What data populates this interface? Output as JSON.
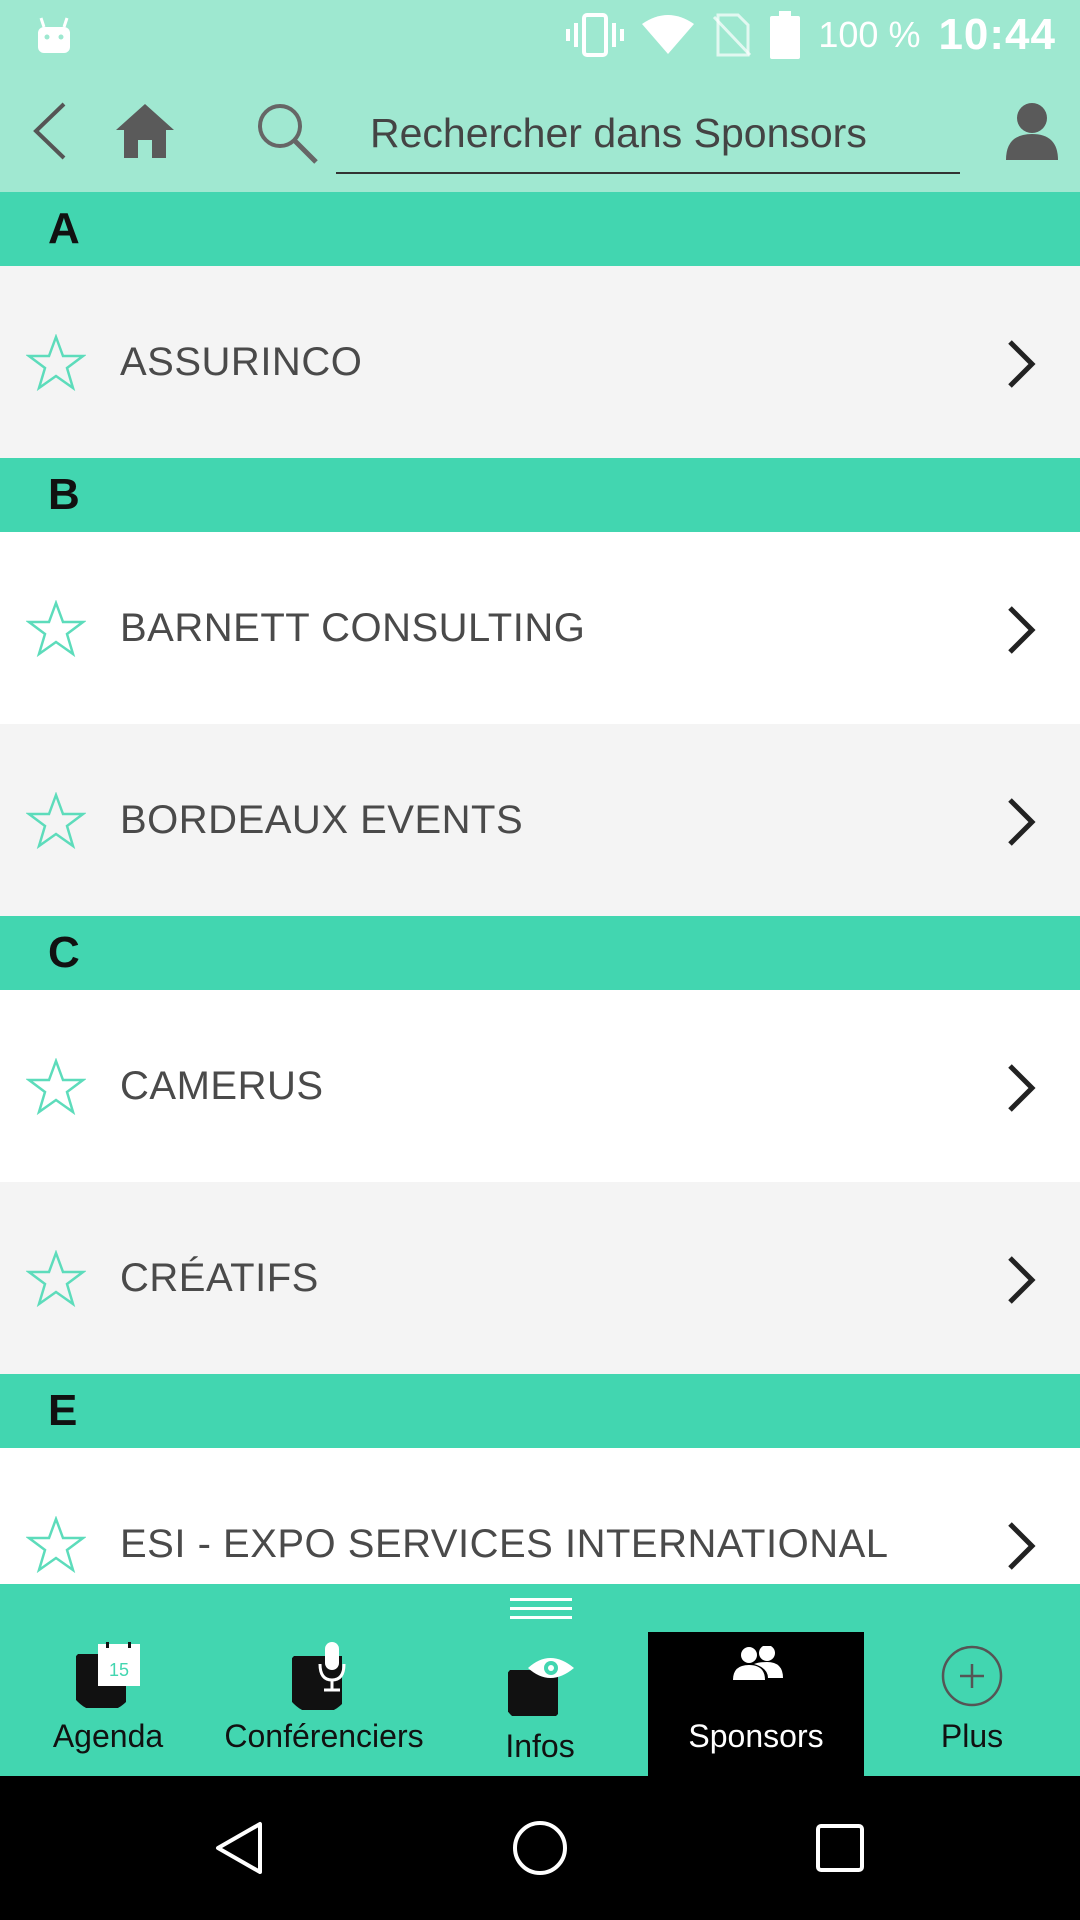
{
  "status_bar": {
    "battery_percent": "100 %",
    "time": "10:44",
    "icons": [
      "android-icon",
      "vibrate-icon",
      "wifi-icon",
      "no-sim-icon",
      "battery-icon"
    ]
  },
  "toolbar": {
    "search_placeholder": "Rechercher dans Sponsors",
    "icons": [
      "back-arrow-icon",
      "home-icon",
      "search-icon",
      "user-icon"
    ]
  },
  "sections": [
    {
      "letter": "A",
      "items": [
        {
          "name": "ASSURINCO"
        }
      ]
    },
    {
      "letter": "B",
      "items": [
        {
          "name": "BARNETT CONSULTING"
        },
        {
          "name": "BORDEAUX EVENTS"
        }
      ]
    },
    {
      "letter": "C",
      "items": [
        {
          "name": "CAMERUS"
        },
        {
          "name": "CRÉATIFS"
        }
      ]
    },
    {
      "letter": "E",
      "items": [
        {
          "name": "ESI - EXPO SERVICES INTERNATIONAL"
        }
      ]
    }
  ],
  "tabs": [
    {
      "label": "Agenda",
      "icon": "calendar-icon",
      "calendar_day": "15"
    },
    {
      "label": "Conférenciers",
      "icon": "microphone-icon"
    },
    {
      "label": "Infos",
      "icon": "eye-icon"
    },
    {
      "label": "Sponsors",
      "icon": "people-icon",
      "active": true
    },
    {
      "label": "Plus",
      "icon": "plus-circle-icon"
    }
  ],
  "colors": {
    "status_bar": "#9ee8d0",
    "toolbar": "#a0e8d1",
    "accent": "#42d6b0",
    "row_alt": "#f4f4f4",
    "star": "#5ddcbb",
    "active_tab": "#000000"
  },
  "nav_bar": {
    "icons": [
      "nav-back-icon",
      "nav-home-icon",
      "nav-recents-icon"
    ]
  }
}
